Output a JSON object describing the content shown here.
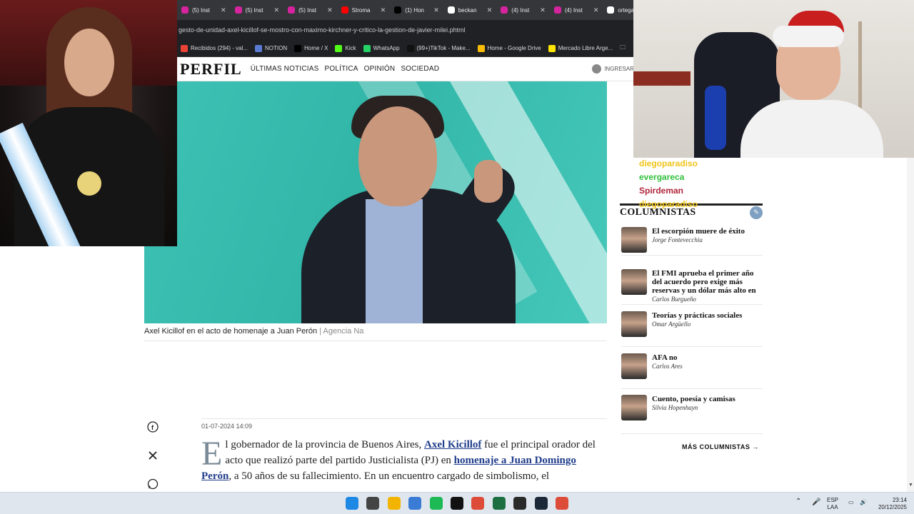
{
  "browser": {
    "tabs": [
      {
        "label": "(5) Inst",
        "color": "#d6249f"
      },
      {
        "label": "(5) Inst",
        "color": "#d6249f"
      },
      {
        "label": "(5) Inst",
        "color": "#d6249f"
      },
      {
        "label": "Stroma",
        "color": "#ff0000"
      },
      {
        "label": "(1) Hon",
        "color": "#000000"
      },
      {
        "label": "beckan",
        "color": "#ffffff"
      },
      {
        "label": "(4) Inst",
        "color": "#d6249f"
      },
      {
        "label": "(4) Inst",
        "color": "#d6249f"
      },
      {
        "label": "ortega",
        "color": "#ffffff"
      }
    ],
    "url": "gesto-de-unidad-axel-kicillof-se-mostro-con-maximo-kirchner-y-critico-la-gestion-de-javier-milei.phtml",
    "bookmarks": [
      {
        "label": "Recibidos (294) - val...",
        "color": "#ea4335"
      },
      {
        "label": "NOTION",
        "color": "#5b7bd5"
      },
      {
        "label": "Home / X",
        "color": "#000000"
      },
      {
        "label": "Kick",
        "color": "#53fc18"
      },
      {
        "label": "WhatsApp",
        "color": "#25d366"
      },
      {
        "label": "(99+)TikTok - Make...",
        "color": "#111111"
      },
      {
        "label": "Home - Google Drive",
        "color": "#fbbc04"
      },
      {
        "label": "Mercado Libre Arge...",
        "color": "#ffe600"
      }
    ]
  },
  "site": {
    "logo": "PERFIL",
    "nav": [
      "ÚLTIMAS NOTICIAS",
      "POLÍTICA",
      "OPINIÓN",
      "SOCIEDAD"
    ],
    "login": "INGRESAR"
  },
  "article": {
    "caption": "Axel Kicillof en el acto de homenaje a Juan Perón",
    "caption_agency": "| Agencia Na",
    "date": "01-07-2024 14:09",
    "dropcap": "E",
    "p1": "l gobernador de la provincia de Buenos Aires, ",
    "link1": "Axel Kicillof",
    "p2": " fue el principal orador del acto que realizó parte del partido Justicialista (PJ) en ",
    "link2": "homenaje a Juan Domingo Perón",
    "p3": ", a 50 años de su fallecimiento. En un encuentro cargado de simbolismo, el"
  },
  "share_icons": [
    "facebook-icon",
    "x-icon",
    "whatsapp-icon"
  ],
  "chat": [
    {
      "user": "diegoparadiso",
      "color": "#f0c419"
    },
    {
      "user": "evergareca",
      "color": "#2fbf3a"
    },
    {
      "user": "Spirdeman",
      "color": "#b0243a"
    },
    {
      "user": "diegoparadiso",
      "color": "#f0c419"
    }
  ],
  "sidebar": {
    "heading": "COLUMNISTAS",
    "items": [
      {
        "title": "El escorpión muere de éxito",
        "author": "Jorge Fontevecchia"
      },
      {
        "title": "El FMI aprueba el primer año del acuerdo pero exige más reservas y un dólar más alto en",
        "author": "Carlos Burgueño"
      },
      {
        "title": "Teorías y prácticas sociales",
        "author": "Omar Argüello"
      },
      {
        "title": "AFA no",
        "author": "Carlos Ares"
      },
      {
        "title": "Cuento, poesía y camisas",
        "author": "Silvia Hopenhayn"
      }
    ],
    "more": "MÁS COLUMNISTAS →"
  },
  "taskbar": {
    "icons": [
      {
        "name": "windows-start-icon",
        "color": "#1e88e5"
      },
      {
        "name": "obs-icon",
        "color": "#444444"
      },
      {
        "name": "file-explorer-icon",
        "color": "#f2b400"
      },
      {
        "name": "calendar-icon",
        "color": "#3a7bd5"
      },
      {
        "name": "spotify-icon",
        "color": "#1db954"
      },
      {
        "name": "capcut-icon",
        "color": "#111111"
      },
      {
        "name": "chrome-icon",
        "color": "#dd4b39"
      },
      {
        "name": "excel-icon",
        "color": "#1d6f42"
      },
      {
        "name": "epic-games-icon",
        "color": "#2a2a2a"
      },
      {
        "name": "steam-icon",
        "color": "#1b2838"
      },
      {
        "name": "chrome-icon",
        "color": "#dd4b39"
      }
    ],
    "lang_top": "ESP",
    "lang_bottom": "LAA",
    "time": "23:14",
    "date": "20/12/2025"
  }
}
